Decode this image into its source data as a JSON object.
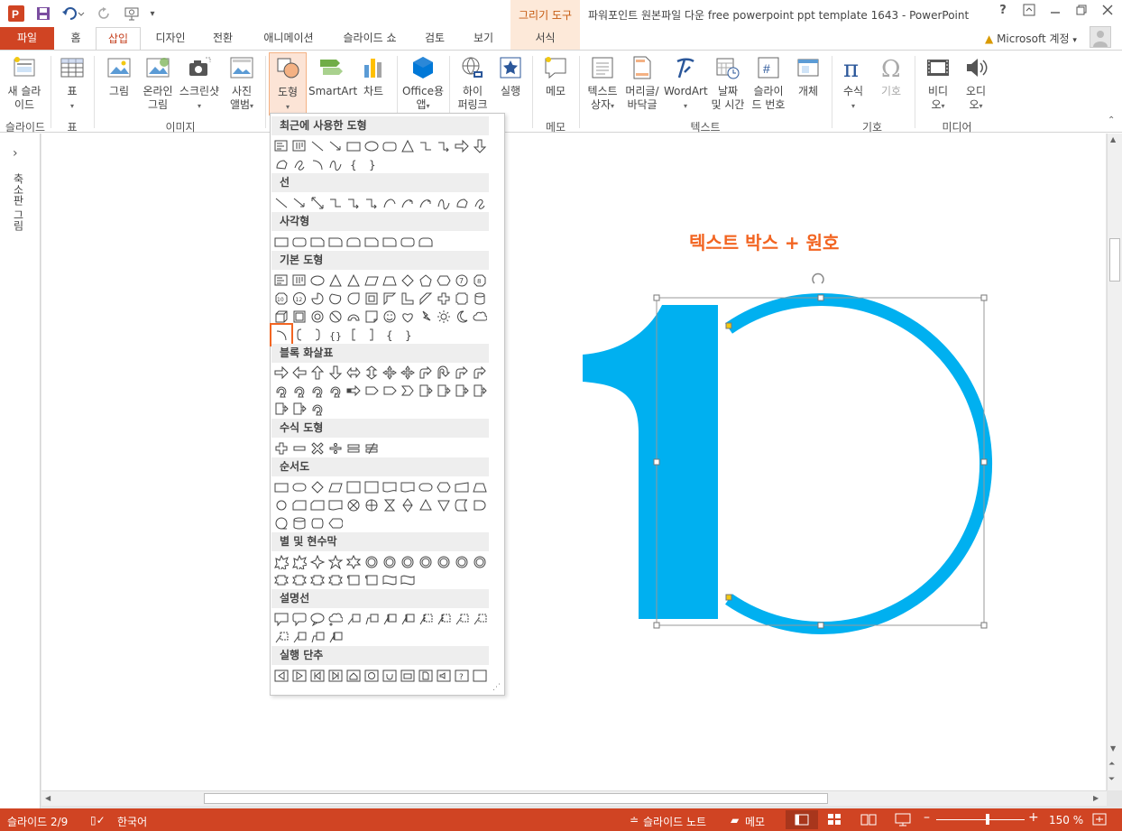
{
  "app": {
    "title": "파워포인트 원본파일 다운 free powerpoint ppt template 1643 - PowerPoint",
    "contextual_group": "그리기 도구",
    "account": "Microsoft 계정",
    "help": "?",
    "window_controls": [
      "ribbon-display-icon",
      "minimize-icon",
      "restore-icon",
      "close-icon"
    ]
  },
  "tabs": [
    {
      "label": "파일"
    },
    {
      "label": "홈"
    },
    {
      "label": "삽입",
      "active": true
    },
    {
      "label": "디자인"
    },
    {
      "label": "전환"
    },
    {
      "label": "애니메이션"
    },
    {
      "label": "슬라이드 쇼"
    },
    {
      "label": "검토"
    },
    {
      "label": "보기"
    },
    {
      "label": "서식"
    }
  ],
  "ribbon": {
    "new_slide": "새 슬라\n이드",
    "table": "표",
    "picture": "그림",
    "online_picture": "온라인\n그림",
    "screenshot": "스크린샷",
    "photo_album": "사진\n앨범",
    "shapes": "도형",
    "smartart": "SmartArt",
    "chart": "차트",
    "office_apps": "Office용\n앱",
    "hyperlink": "하이\n퍼링크",
    "action": "실행",
    "comment": "메모",
    "textbox": "텍스트\n상자",
    "header_footer": "머리글/\n바닥글",
    "wordart": "WordArt",
    "datetime": "날짜\n및 시간",
    "slide_number": "슬라이\n드 번호",
    "object": "개체",
    "equation": "수식",
    "symbol": "기호",
    "video": "비디\n오",
    "audio": "오디\n오",
    "groups": {
      "slides": "슬라이드",
      "tables": "표",
      "images": "이미지",
      "comments": "메모",
      "text": "텍스트",
      "symbols": "기호",
      "media": "미디어"
    }
  },
  "left_pane": {
    "label": "축소판 그림"
  },
  "slide": {
    "heading": "텍스트 박스 + 원호",
    "big_digit": "1",
    "accent_color": "#00b0f0",
    "heading_color": "#f26522"
  },
  "shapes_gallery": {
    "sections": [
      "최근에 사용한 도형",
      "선",
      "사각형",
      "기본 도형",
      "블록 화살표",
      "수식 도형",
      "순서도",
      "별 및 현수막",
      "설명선",
      "실행 단추"
    ],
    "selected_shape": "arc",
    "highlight_color": "#f26522"
  },
  "status": {
    "slide": "슬라이드 2/9",
    "language": "한국어",
    "notes": "슬라이드 노트",
    "comments": "메모",
    "zoom": "150 %"
  }
}
